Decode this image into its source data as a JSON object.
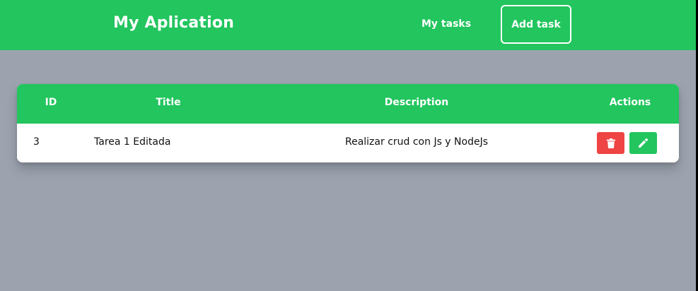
{
  "navbar": {
    "brand": "My Aplication",
    "links": {
      "my_tasks": "My tasks",
      "add_task": "Add task"
    }
  },
  "table": {
    "headers": {
      "id": "ID",
      "title": "Title",
      "description": "Description",
      "actions": "Actions"
    },
    "rows": [
      {
        "id": "3",
        "title": "Tarea 1 Editada",
        "description": "Realizar crud con Js y NodeJs",
        "actions": {
          "delete_icon": "trash-icon",
          "edit_icon": "pencil-icon"
        }
      }
    ]
  },
  "colors": {
    "primary": "#22c55e",
    "danger": "#ef4444",
    "background": "#9ca3af",
    "surface": "#ffffff"
  }
}
